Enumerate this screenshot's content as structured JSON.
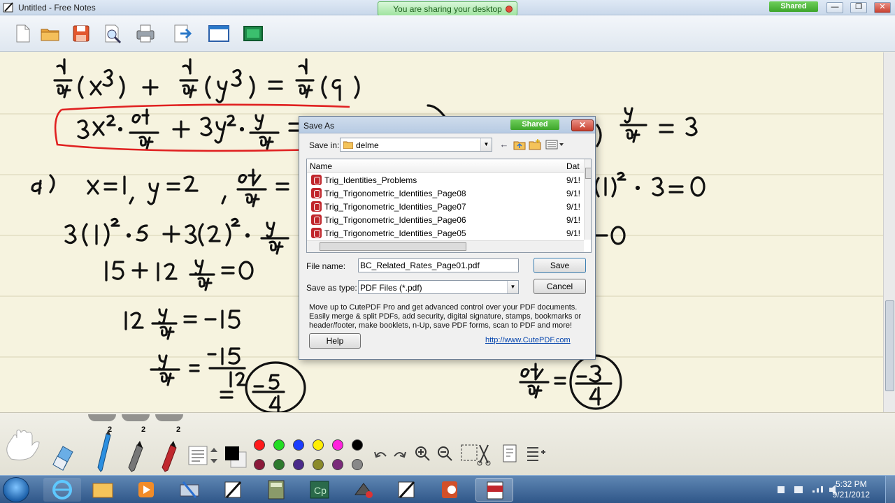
{
  "app": {
    "title": "Untitled - Free Notes",
    "sharing_status": "You are sharing your desktop",
    "shared_badge": "Shared"
  },
  "toolbar": {
    "items": [
      "new-page",
      "open-folder",
      "save",
      "preview",
      "print",
      "export",
      "screen",
      "capture"
    ]
  },
  "palette": {
    "page_counts": [
      "2",
      "2",
      "2"
    ],
    "colors_top": [
      "#000000",
      "#ff1a1a",
      "#22dd22",
      "#1a3cff",
      "#ffee00",
      "#ff22dd",
      "#000000"
    ],
    "colors_bottom": [
      "#8b1a3a",
      "#2e7a2e",
      "#4a2a8a",
      "#8a8a2a",
      "#7a2a7a",
      "#888888"
    ]
  },
  "taskbar": {
    "time": "5:32 PM",
    "date": "9/21/2012"
  },
  "dialog": {
    "title": "Save As",
    "shared_badge": "Shared",
    "save_in_label": "Save in:",
    "save_in_value": "delme",
    "columns": {
      "name": "Name",
      "date": "Dat"
    },
    "files": [
      {
        "name": "Trig_Identities_Problems",
        "date": "9/1!"
      },
      {
        "name": "Trig_Trigonometric_Identities_Page08",
        "date": "9/1!"
      },
      {
        "name": "Trig_Trigonometric_Identities_Page07",
        "date": "9/1!"
      },
      {
        "name": "Trig_Trigonometric_Identities_Page06",
        "date": "9/1!"
      },
      {
        "name": "Trig_Trigonometric_Identities_Page05",
        "date": "9/1!"
      }
    ],
    "file_name_label": "File name:",
    "file_name_value": "BC_Related_Rates_Page01.pdf",
    "save_type_label": "Save as type:",
    "save_type_value": "PDF Files (*.pdf)",
    "save_button": "Save",
    "cancel_button": "Cancel",
    "help_button": "Help",
    "promo_text": "Move up to CutePDF Pro and get advanced control over your PDF documents. Easily merge & split PDFs, add security, digital signature, stamps, bookmarks or header/footer, make booklets, n-Up, save PDF forms, scan to PDF and more!",
    "promo_link": "http://www.CutePDF.com"
  }
}
